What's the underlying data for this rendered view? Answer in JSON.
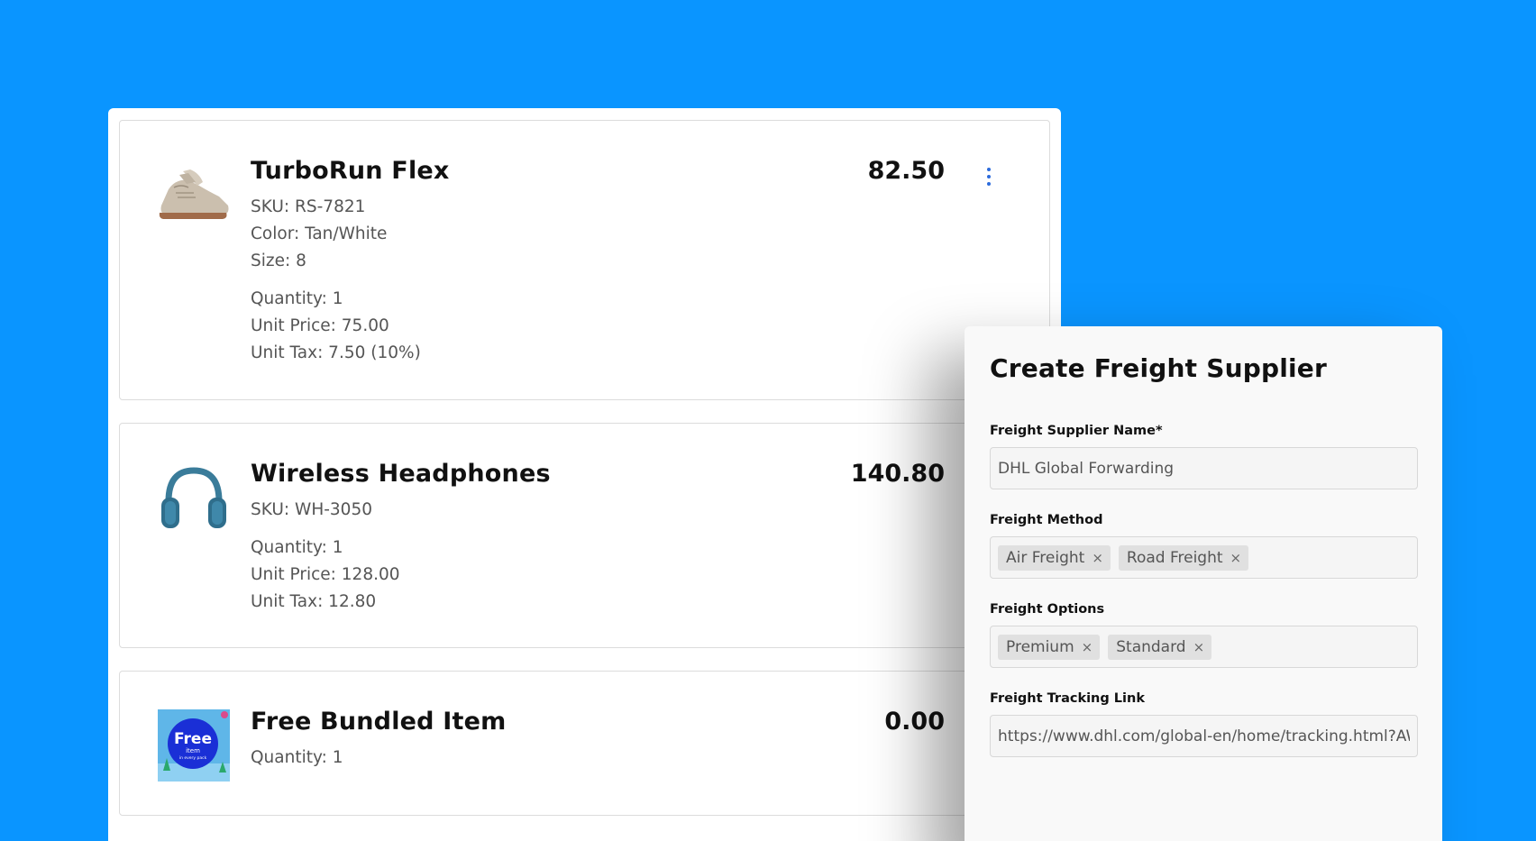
{
  "orders": [
    {
      "title": "TurboRun Flex",
      "price": "82.50",
      "details": [
        "SKU: RS-7821",
        "Color: Tan/White",
        "Size: 8"
      ],
      "pricing": [
        "Quantity: 1",
        "Unit Price: 75.00",
        "Unit Tax: 7.50 (10%)"
      ],
      "thumb_icon": "sneaker-icon"
    },
    {
      "title": "Wireless Headphones",
      "price": "140.80",
      "details": [
        "SKU: WH-3050"
      ],
      "pricing": [
        "Quantity: 1",
        "Unit Price: 128.00",
        "Unit Tax: 12.80"
      ],
      "thumb_icon": "headphones-icon"
    },
    {
      "title": "Free Bundled Item",
      "price": "0.00",
      "details": [],
      "pricing": [
        "Quantity: 1"
      ],
      "thumb_icon": "free-item-badge-icon",
      "thumb_text": {
        "big": "Free",
        "small": "item",
        "tiny": "in every pack"
      }
    }
  ],
  "menu_icon": "kebab-menu-icon",
  "freight_form": {
    "title": "Create Freight Supplier",
    "supplier_name": {
      "label": "Freight Supplier Name*",
      "value": "DHL Global Forwarding"
    },
    "method": {
      "label": "Freight Method",
      "chips": [
        "Air Freight",
        "Road Freight"
      ]
    },
    "options": {
      "label": "Freight Options",
      "chips": [
        "Premium",
        "Standard"
      ]
    },
    "tracking": {
      "label": "Freight Tracking Link",
      "value": "https://www.dhl.com/global-en/home/tracking.html?AWB"
    },
    "chip_remove_glyph": "×"
  },
  "colors": {
    "background": "#0A95FF",
    "accent_menu": "#2C6BDC",
    "chip_bg": "#E0E0E0"
  }
}
